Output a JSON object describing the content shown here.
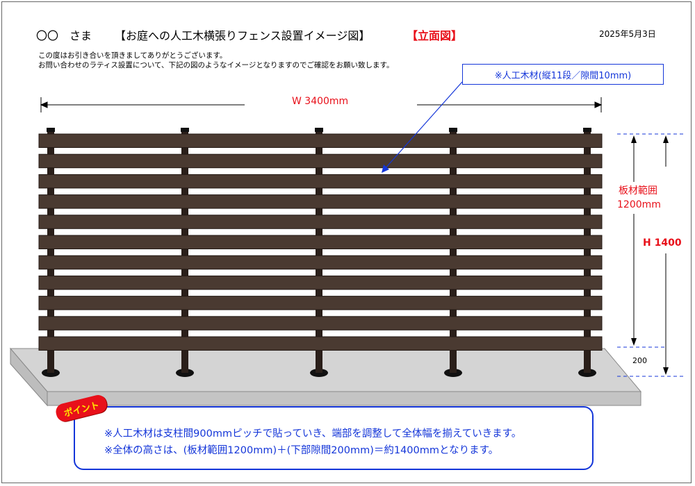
{
  "header": {
    "customer": "〇〇　さま",
    "title": "【お庭への人工木横張りフェンス設置イメージ図】",
    "view_label": "【立面図】",
    "date": "2025年5月3日"
  },
  "intro": {
    "line1": "この度はお引き合いを頂きましてありがとうございます。",
    "line2": "お問い合わせのラティス設置について、下記の図のようなイメージとなりますのでご確認をお願い致します。"
  },
  "annotations": {
    "material": "※人工木材(縦11段／隙間10mm)",
    "width": "W 3400mm",
    "board_range_line1": "板材範囲",
    "board_range_line2": "1200mm",
    "height": "H 1400",
    "bottom_gap": "200"
  },
  "fence": {
    "board_count": 11,
    "post_count": 5,
    "board_color": "#4a3a31",
    "post_color": "#2a1f1a"
  },
  "point": {
    "badge": "ポイント",
    "line1": "※人工木材は支柱間900mmピッチで貼っていき、端部を調整して全体幅を揃えていきます。",
    "line2": "※全体の高さは、(板材範囲1200mm)＋(下部隙間200mm)＝約1400mmとなります。"
  },
  "colors": {
    "accent_red": "#e8101a",
    "accent_blue": "#1436d9",
    "slab": "#d4d4d4"
  }
}
